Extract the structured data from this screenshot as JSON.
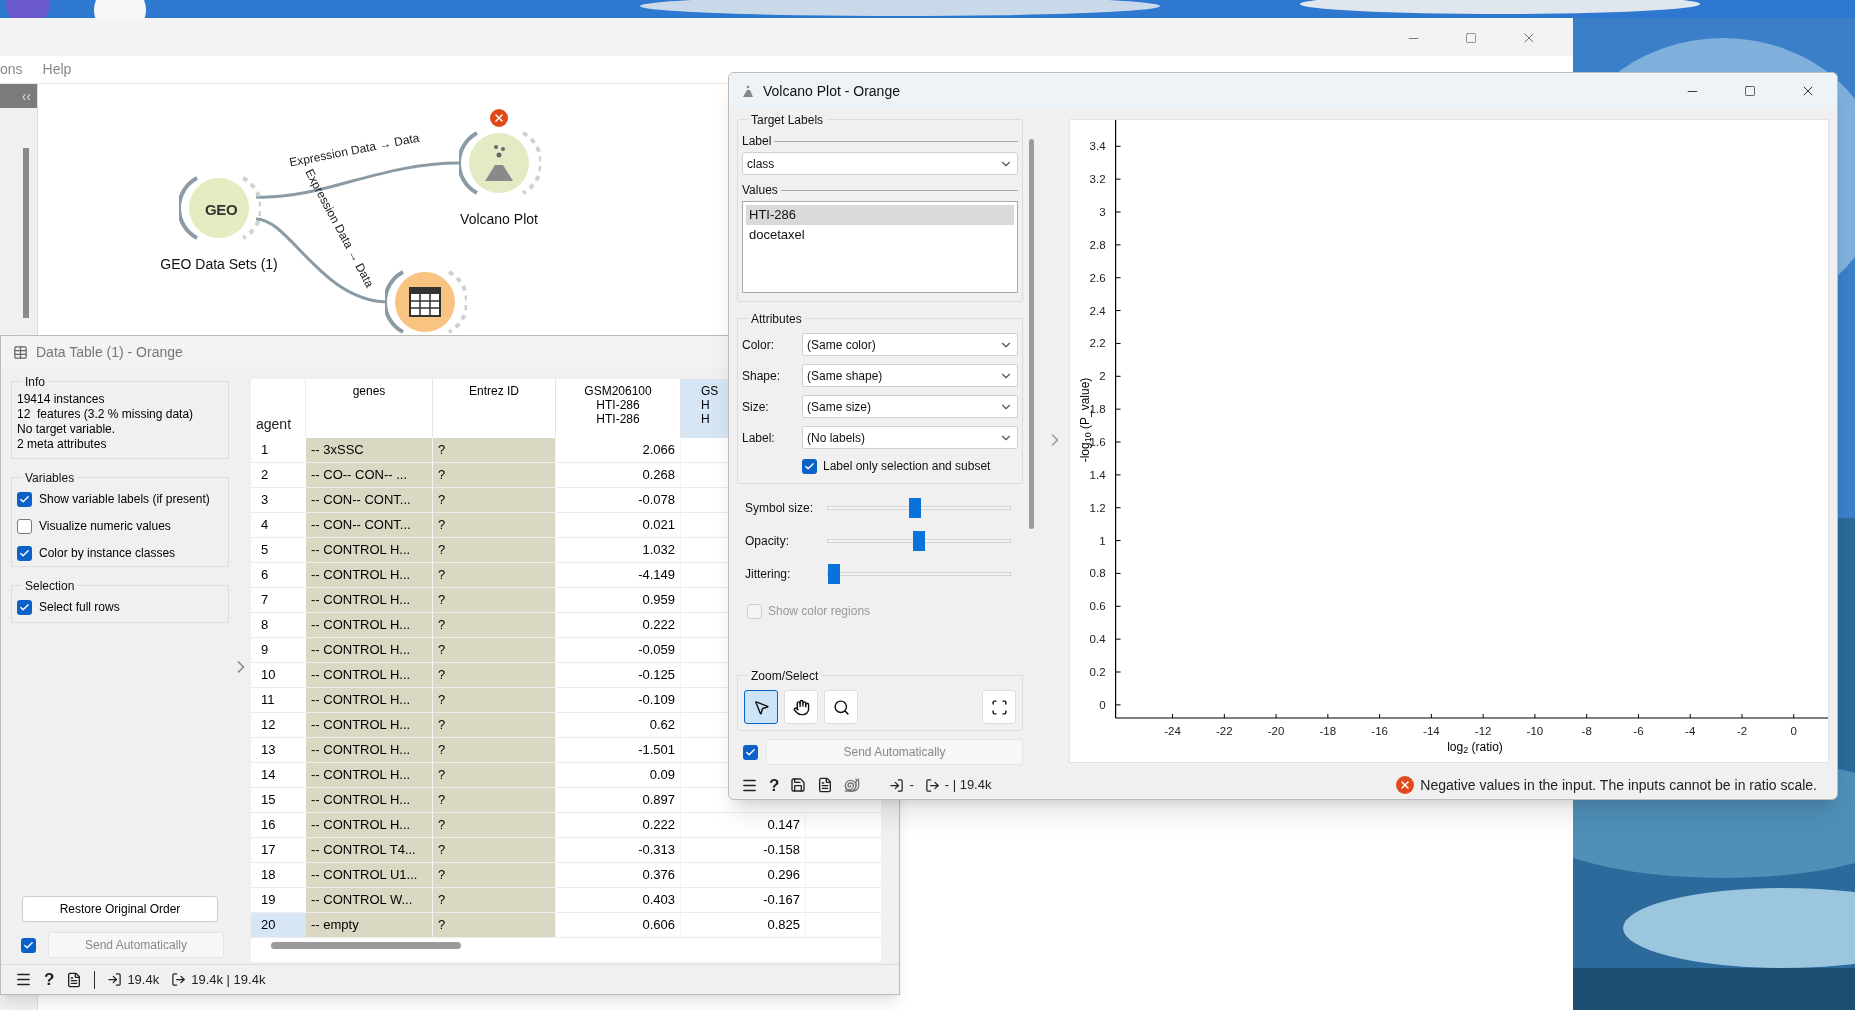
{
  "main_window": {
    "menu": [
      "ons",
      "Help"
    ],
    "dock_toggle": "‹‹"
  },
  "canvas": {
    "nodes": [
      {
        "kind": "geo",
        "label": "GEO Data Sets (1)",
        "icon_text": "GEO",
        "error": false
      },
      {
        "kind": "volcano",
        "label": "Volcano Plot",
        "error": true
      },
      {
        "kind": "table",
        "error": false
      }
    ],
    "links": [
      {
        "label": "Expression Data → Data"
      },
      {
        "label": "Expression Data → Data"
      }
    ]
  },
  "data_table": {
    "title": "Data Table (1) - Orange",
    "info": {
      "title": "Info",
      "lines": [
        "19414 instances",
        "12  features (3.2 % missing data)",
        "No target variable.",
        "2 meta attributes"
      ]
    },
    "variables": {
      "title": "Variables",
      "options": [
        {
          "label": "Show variable labels (if present)",
          "checked": true
        },
        {
          "label": "Visualize numeric values",
          "checked": false
        },
        {
          "label": "Color by instance classes",
          "checked": true
        }
      ]
    },
    "selection": {
      "title": "Selection",
      "options": [
        {
          "label": "Select full rows",
          "checked": true
        }
      ]
    },
    "restore_button": "Restore Original Order",
    "send": {
      "label": "Send Automatically",
      "checked": true
    },
    "corner_header": "agent",
    "columns": [
      {
        "lines": [
          "genes"
        ],
        "selected": false
      },
      {
        "lines": [
          "Entrez ID"
        ],
        "selected": false
      },
      {
        "lines": [
          "GSM206100",
          "HTI-286",
          "HTI-286"
        ],
        "selected": false
      },
      {
        "lines": [
          "GS",
          "H",
          "H"
        ],
        "selected": true
      }
    ],
    "rows": [
      {
        "index": "1",
        "cells": [
          "-- 3xSSC",
          "?",
          "2.066"
        ],
        "selected": false
      },
      {
        "index": "2",
        "cells": [
          "-- CO-- CON-- ...",
          "?",
          "0.268"
        ],
        "selected": false
      },
      {
        "index": "3",
        "cells": [
          "-- CON-- CONT...",
          "?",
          "-0.078"
        ],
        "selected": false
      },
      {
        "index": "4",
        "cells": [
          "-- CON-- CONT...",
          "?",
          "0.021"
        ],
        "selected": false
      },
      {
        "index": "5",
        "cells": [
          "-- CONTROL H...",
          "?",
          "1.032"
        ],
        "selected": false
      },
      {
        "index": "6",
        "cells": [
          "-- CONTROL H...",
          "?",
          "-4.149"
        ],
        "selected": false
      },
      {
        "index": "7",
        "cells": [
          "-- CONTROL H...",
          "?",
          "0.959"
        ],
        "selected": false
      },
      {
        "index": "8",
        "cells": [
          "-- CONTROL H...",
          "?",
          "0.222"
        ],
        "selected": false
      },
      {
        "index": "9",
        "cells": [
          "-- CONTROL H...",
          "?",
          "-0.059"
        ],
        "selected": false
      },
      {
        "index": "10",
        "cells": [
          "-- CONTROL H...",
          "?",
          "-0.125"
        ],
        "selected": false
      },
      {
        "index": "11",
        "cells": [
          "-- CONTROL H...",
          "?",
          "-0.109"
        ],
        "selected": false
      },
      {
        "index": "12",
        "cells": [
          "-- CONTROL H...",
          "?",
          "0.62"
        ],
        "selected": false
      },
      {
        "index": "13",
        "cells": [
          "-- CONTROL H...",
          "?",
          "-1.501"
        ],
        "selected": false
      },
      {
        "index": "14",
        "cells": [
          "-- CONTROL H...",
          "?",
          "0.09"
        ],
        "selected": false
      },
      {
        "index": "15",
        "cells": [
          "-- CONTROL H...",
          "?",
          "0.897"
        ],
        "selected": false
      },
      {
        "index": "16",
        "cells": [
          "-- CONTROL H...",
          "?",
          "0.222",
          "0.147"
        ],
        "selected": false
      },
      {
        "index": "17",
        "cells": [
          "-- CONTROL T4...",
          "?",
          "-0.313",
          "-0.158"
        ],
        "selected": false
      },
      {
        "index": "18",
        "cells": [
          "-- CONTROL U1...",
          "?",
          "0.376",
          "0.296"
        ],
        "selected": false
      },
      {
        "index": "19",
        "cells": [
          "-- CONTROL W...",
          "?",
          "0.403",
          "-0.167"
        ],
        "selected": false
      },
      {
        "index": "20",
        "cells": [
          "-- empty",
          "?",
          "0.606",
          "0.825"
        ],
        "selected": true
      }
    ],
    "status": {
      "help": "?",
      "input": "19.4k",
      "output": "19.4k | 19.4k"
    }
  },
  "volcano": {
    "title": "Volcano Plot - Orange",
    "target_labels": {
      "title": "Target Labels",
      "label_caption": "Label",
      "label_value": "class",
      "values_caption": "Values",
      "values": [
        {
          "label": "HTI-286",
          "selected": true
        },
        {
          "label": "docetaxel",
          "selected": false
        }
      ]
    },
    "attributes": {
      "title": "Attributes",
      "rows": [
        {
          "label": "Color:",
          "value": "(Same color)"
        },
        {
          "label": "Shape:",
          "value": "(Same shape)"
        },
        {
          "label": "Size:",
          "value": "(Same size)"
        },
        {
          "label": "Label:",
          "value": "(No labels)"
        }
      ],
      "label_only": {
        "label": "Label only selection and subset",
        "checked": true
      }
    },
    "sliders": [
      {
        "label": "Symbol size:",
        "level": 0.475
      },
      {
        "label": "Opacity:",
        "level": 0.5
      },
      {
        "label": "Jittering:",
        "level": 0.0
      }
    ],
    "show_color_regions": {
      "label": "Show color regions",
      "checked": false,
      "disabled": true
    },
    "zoom_select": {
      "title": "Zoom/Select",
      "tools": [
        {
          "kind": "select",
          "selected": true
        },
        {
          "kind": "pan",
          "selected": false
        },
        {
          "kind": "zoom",
          "selected": false
        },
        {
          "kind": "fit",
          "selected": false
        }
      ]
    },
    "send": {
      "label": "Send Automatically",
      "checked": true
    },
    "status": {
      "help": "?",
      "input": "-",
      "output": "- | 19.4k",
      "message": "Negative values in the input. The inputs cannot be in ratio scale."
    },
    "chart_data": {
      "type": "scatter",
      "xlabel": "log$_{2}$ (ratio)",
      "ylabel": "-log$_{10}$ (P_value)",
      "xlim": [
        -26.2,
        1.4
      ],
      "ylim": [
        -0.08,
        3.56
      ],
      "xticks": [
        -24,
        -22,
        -20,
        -18,
        -16,
        -14,
        -12,
        -10,
        -8,
        -6,
        -4,
        -2,
        0
      ],
      "yticks": [
        0,
        0.2,
        0.4,
        0.6,
        0.8,
        1,
        1.2,
        1.4,
        1.6,
        1.8,
        2,
        2.2,
        2.4,
        2.6,
        2.8,
        3,
        3.2,
        3.4
      ]
    }
  }
}
